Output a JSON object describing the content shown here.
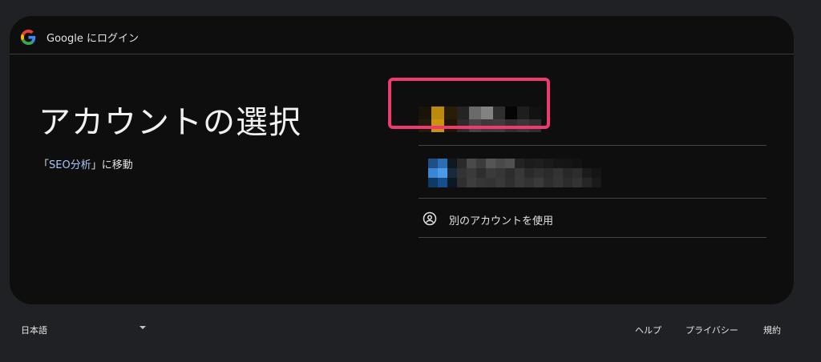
{
  "header": {
    "title": "Google にログイン",
    "logo_icon": "google-g-icon"
  },
  "main": {
    "title": "アカウントの選択",
    "subtitle_prefix": "「",
    "subtitle_link": "SEO分析",
    "subtitle_suffix": "」に移動"
  },
  "accounts": {
    "highlight_color": "#f03a6f",
    "use_other_label": "別のアカウントを使用",
    "use_other_icon": "person-circle-icon"
  },
  "footer": {
    "language": "日本語",
    "help": "ヘルプ",
    "privacy": "プライバシー",
    "terms": "規約"
  },
  "colors": {
    "page_bg": "#202124",
    "card_bg": "#0e0e0e",
    "link": "#a8c7fa",
    "highlight": "#f03a6f"
  }
}
